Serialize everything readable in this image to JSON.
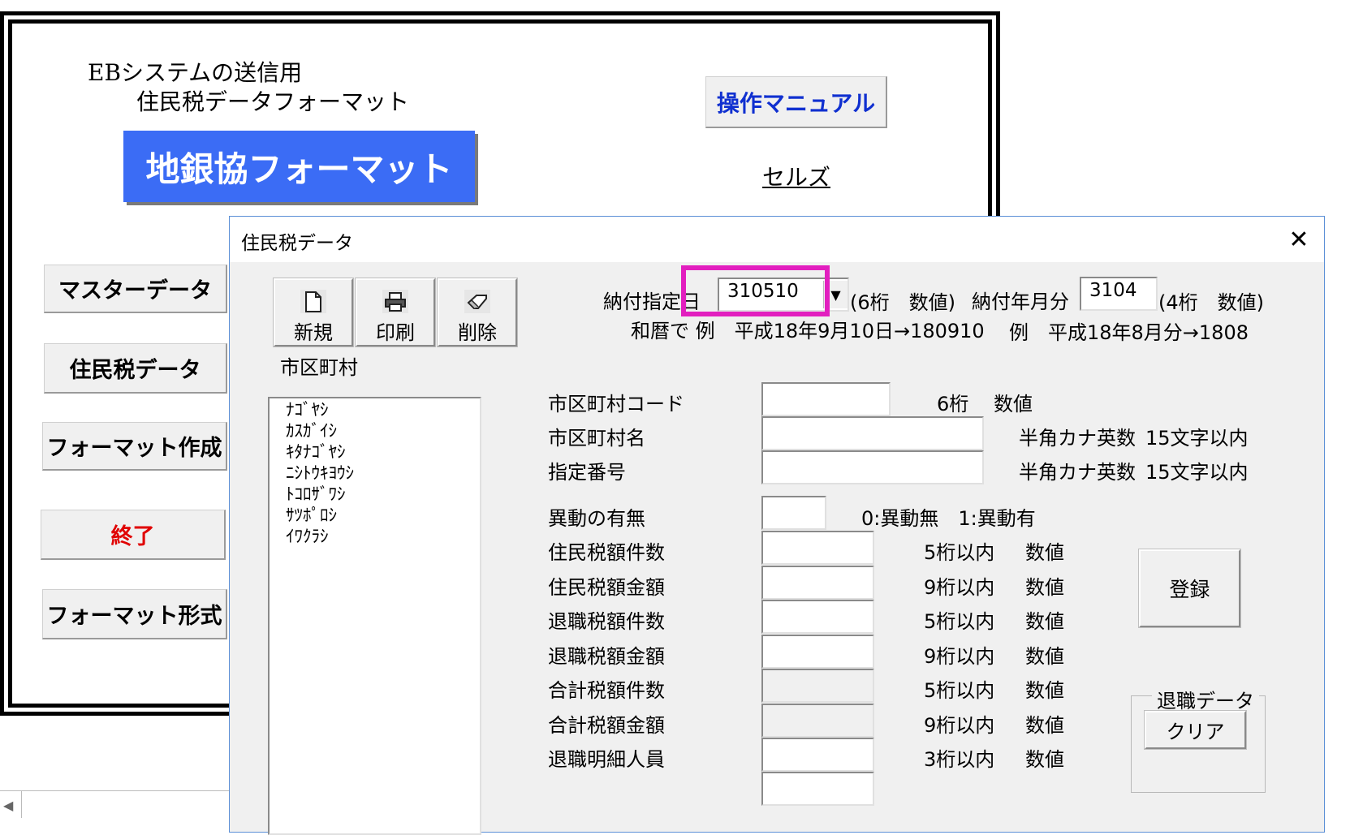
{
  "menu": {
    "title_line1": "EBシステムの送信用",
    "title_line2": "住民税データフォーマット",
    "logo": "地銀協フォーマット",
    "manual_button": "操作マニュアル",
    "cells_link": "セルズ",
    "buttons": {
      "master": "マスターデータ",
      "juminzei": "住民税データ",
      "format_create": "フォーマット作成",
      "exit": "終了",
      "format_type": "フォーマット形式"
    },
    "colors": {
      "logo_bg": "#3b6cf5",
      "manual_text": "#1030d0",
      "exit_text": "#e00000"
    }
  },
  "sheet": {
    "scroll_left_icon": "triangle-left-icon",
    "scroll_left_glyph": "◀"
  },
  "dialog": {
    "title": "住民税データ",
    "close_glyph": "✕",
    "toolbar": {
      "new": {
        "label": "新規",
        "icon": "new-document-icon"
      },
      "print": {
        "label": "印刷",
        "icon": "printer-icon"
      },
      "delete": {
        "label": "削除",
        "icon": "eraser-icon"
      }
    },
    "payment_date": {
      "label": "納付指定日",
      "value": "310510",
      "hint": "(6桁　数値)",
      "example": "和暦で 例　平成18年9月10日→180910",
      "dropdown_glyph": "▼"
    },
    "payment_month": {
      "label": "納付年月分",
      "value": "3104",
      "hint": "(4桁　数値)",
      "example": "例　平成18年8月分→1808"
    },
    "municipality_list": {
      "label": "市区町村",
      "items": [
        "ﾅｺﾞﾔｼ",
        "ｶｽｶﾞｲｼ",
        "ｷﾀﾅｺﾞﾔｼ",
        "ﾆｼﾄｳｷﾖｳｼ",
        "ﾄｺﾛｻﾞﾜｼ",
        "ｻﾂﾎﾟﾛｼ",
        "ｲﾜｸﾗｼ"
      ]
    },
    "fields": [
      {
        "label": "市区町村コード",
        "hint1": "6桁",
        "hint2": "数値",
        "value": ""
      },
      {
        "label": "市区町村名",
        "hint1": "半角カナ英数",
        "hint2": "15文字以内",
        "value": ""
      },
      {
        "label": "指定番号",
        "hint1": "半角カナ英数",
        "hint2": "15文字以内",
        "value": ""
      },
      {
        "label": "異動の有無",
        "hint1": "0:異動無　1:異動有",
        "hint2": "",
        "value": ""
      },
      {
        "label": "住民税額件数",
        "hint1": "5桁以内",
        "hint2": "数値",
        "value": ""
      },
      {
        "label": "住民税額金額",
        "hint1": "9桁以内",
        "hint2": "数値",
        "value": ""
      },
      {
        "label": "退職税額件数",
        "hint1": "5桁以内",
        "hint2": "数値",
        "value": ""
      },
      {
        "label": "退職税額金額",
        "hint1": "9桁以内",
        "hint2": "数値",
        "value": ""
      },
      {
        "label": "合計税額件数",
        "hint1": "5桁以内",
        "hint2": "数値",
        "value": ""
      },
      {
        "label": "合計税額金額",
        "hint1": "9桁以内",
        "hint2": "数値",
        "value": ""
      },
      {
        "label": "退職明細人員",
        "hint1": "3桁以内",
        "hint2": "数値",
        "value": ""
      }
    ],
    "register_button": "登録",
    "retire_group": {
      "caption": "退職データ",
      "clear_button": "クリア"
    },
    "highlight_color": "#e21fbf"
  }
}
